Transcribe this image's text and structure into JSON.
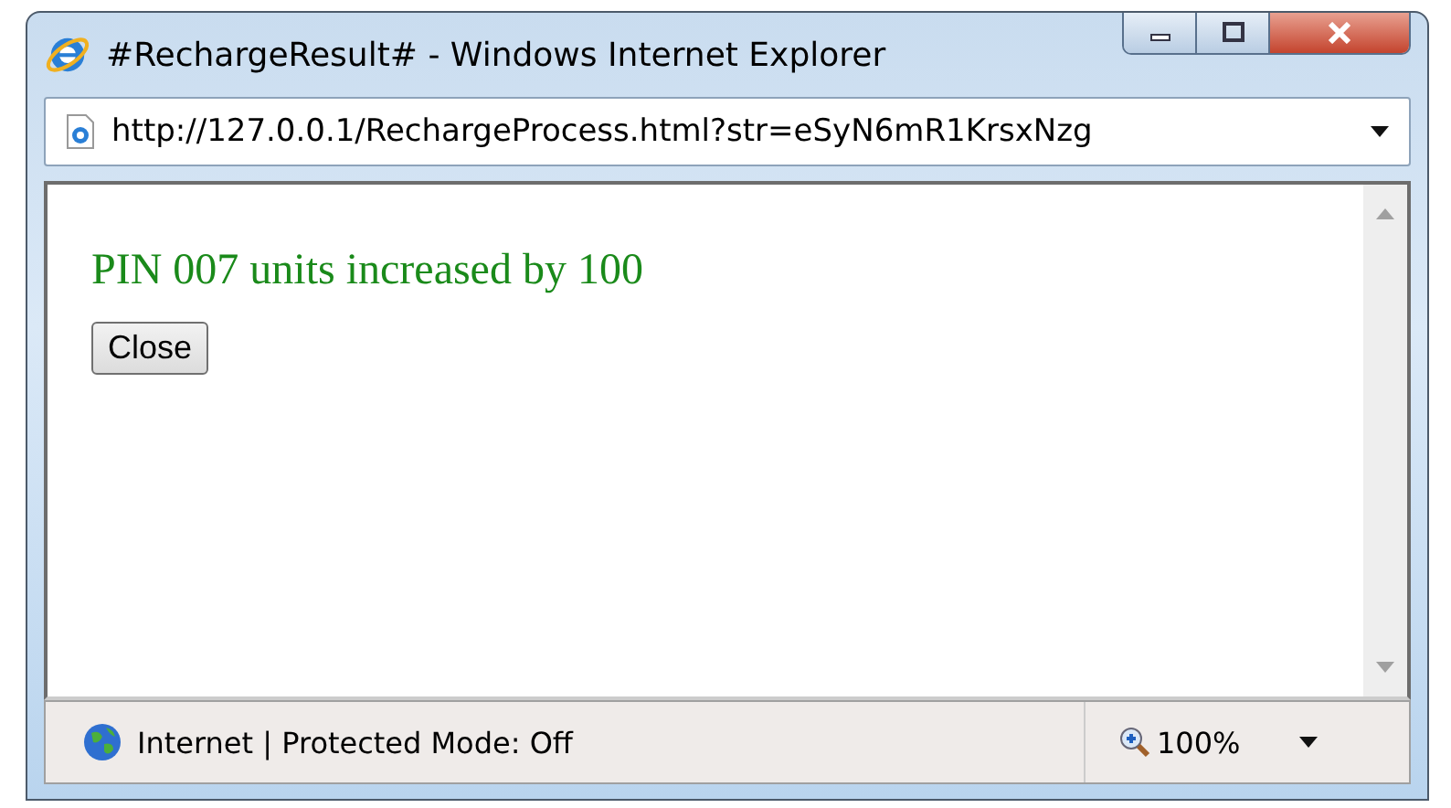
{
  "window": {
    "title": "#RechargeResult# - Windows Internet Explorer"
  },
  "address_bar": {
    "value": "http://127.0.0.1/RechargeProcess.html?str=eSyN6mR1KrsxNzg"
  },
  "content": {
    "message": "PIN 007 units increased by 100",
    "button": "Close"
  },
  "status_bar": {
    "zone": "Internet | Protected Mode: Off",
    "zoom": "100%"
  }
}
